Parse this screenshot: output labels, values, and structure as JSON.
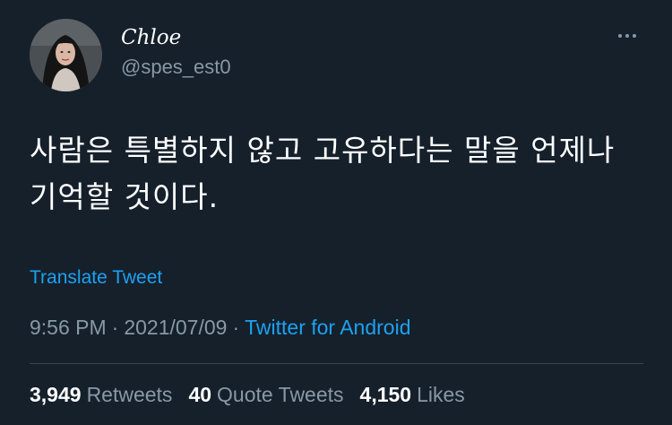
{
  "tweet": {
    "author": {
      "display_name": "Chloe",
      "handle": "@spes_est0"
    },
    "text": "사람은 특별하지 않고 고유하다는 말을 언제나 기억할 것이다.",
    "translate_label": "Translate Tweet",
    "time": "9:56 PM",
    "date": "2021/07/09",
    "separator": "·",
    "source": "Twitter for Android",
    "stats": {
      "retweets_count": "3,949",
      "retweets_label": "Retweets",
      "quote_tweets_count": "40",
      "quote_tweets_label": "Quote Tweets",
      "likes_count": "4,150",
      "likes_label": "Likes"
    }
  },
  "colors": {
    "background": "#15202b",
    "text_primary": "#ffffff",
    "text_secondary": "#8899a6",
    "link": "#1da1f2",
    "divider": "#38444d"
  },
  "icons": {
    "more": "more-horizontal-icon"
  }
}
